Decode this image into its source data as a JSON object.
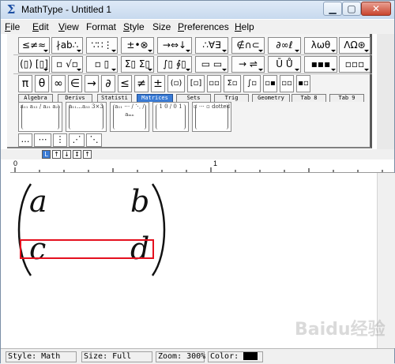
{
  "window": {
    "title": "MathType - Untitled 1"
  },
  "menu": [
    {
      "label": "File",
      "u": "F",
      "rest": "ile"
    },
    {
      "label": "Edit",
      "u": "E",
      "rest": "dit"
    },
    {
      "label": "View",
      "u": "V",
      "rest": "iew"
    },
    {
      "label": "Format",
      "u": "",
      "rest": "Format"
    },
    {
      "label": "Style",
      "u": "S",
      "rest": "tyle"
    },
    {
      "label": "Size",
      "u": "",
      "rest": "Size"
    },
    {
      "label": "Preferences",
      "u": "P",
      "rest": "references"
    },
    {
      "label": "Help",
      "u": "H",
      "rest": "elp"
    }
  ],
  "palettes": {
    "row1": [
      "≤≠≈",
      "∤ab∴",
      "∵∷⋮",
      "±•⊗",
      "→⇔↓",
      "∴∀∃",
      "∉∩⊂",
      "∂∞ℓ",
      "λωθ",
      "ΛΩ⊛"
    ],
    "row2": [
      "(▯) [▯]",
      "▫ √▫",
      "▫ ▯",
      "Σ▯ Σ▯",
      "∫▯ ∮▯",
      "▭ ▭",
      "→ ⇌",
      "Ū Ů",
      "▪▪▪",
      "▫▫▫"
    ]
  },
  "small_symbols": [
    "π",
    "θ",
    "∞",
    "∈",
    "→",
    "∂",
    "≤",
    "≠",
    "±",
    "(▫)",
    "[▫]",
    "▫▫",
    "Σ▫",
    "∫▫",
    "▫▪",
    "▫▫",
    "▪▫"
  ],
  "tabs": [
    "Algebra",
    "Derivs",
    "Statisti",
    "Matrices",
    "Sets",
    "Trig",
    "Geometry",
    "Tab 8",
    "Tab 9"
  ],
  "active_tab": "Matrices",
  "templates": [
    "a₁₁ a₁₂ / a₂₁ a₂₂",
    "a₁₁…a₃₃ 3×3",
    "a₁₁ ⋯ / ⋱ / aₘₙ",
    "1 0 / 0 1",
    "▫ ⋯ ▫ dotted"
  ],
  "dots": [
    "…",
    "⋯",
    "⋮",
    "⋰",
    "⋱"
  ],
  "tab_stops": [
    "L",
    "↑",
    "↓",
    "↕",
    "↑"
  ],
  "ruler": {
    "labels": [
      "0",
      "1"
    ]
  },
  "matrix": {
    "a": "a",
    "b": "b",
    "c": "c",
    "d": "d"
  },
  "status": {
    "style": "Style: Math",
    "size": "Size: Full",
    "zoom": "Zoom: 300%",
    "color_label": "Color:",
    "color_value": "#000000"
  },
  "watermark": "Baidu经验"
}
